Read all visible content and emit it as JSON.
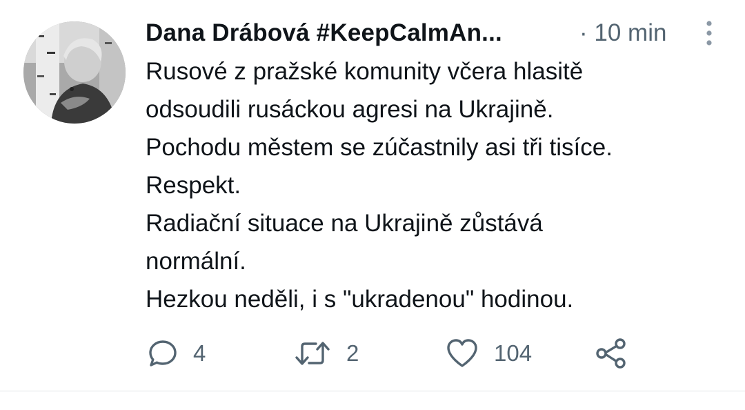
{
  "tweet": {
    "author": "Dana Drábová #KeepCalmAn...",
    "time": "· 10 min",
    "body_lines": [
      "Rusové z pražské komunity včera hlasitě",
      "odsoudili rusáckou agresi na Ukrajině.",
      "Pochodu městem se zúčastnily asi tři tisíce.",
      "Respekt.",
      "Radiační situace na Ukrajině zůstává",
      "normální.",
      "Hezkou neděli, i s \"ukradenou\" hodinou."
    ]
  },
  "actions": {
    "reply_count": "4",
    "retweet_count": "2",
    "like_count": "104"
  },
  "icons": {
    "reply": "reply-icon",
    "retweet": "retweet-icon",
    "like": "heart-icon",
    "share": "share-icon",
    "more": "more-vertical-icon"
  },
  "colors": {
    "text": "#0f1419",
    "secondary": "#536471",
    "divider": "#e1e4e6"
  }
}
